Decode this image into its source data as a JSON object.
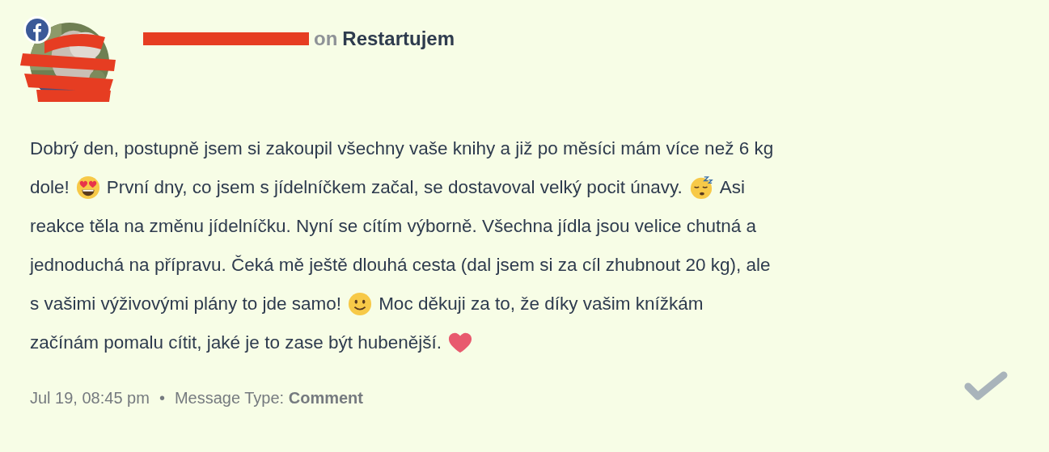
{
  "header": {
    "connector": "on",
    "page_name": "Restartujem"
  },
  "body": [
    [
      {
        "kind": "text",
        "text": "Dobrý den, postupně jsem si zakoupil všechny vaše knihy a již po měsíci mám více než 6 kg"
      }
    ],
    [
      {
        "kind": "text",
        "text": "dole!"
      },
      {
        "kind": "heart_eyes"
      },
      {
        "kind": "text",
        "text": "První dny, co jsem s jídelníčkem začal, se dostavoval velký pocit únavy."
      },
      {
        "kind": "sleepy"
      },
      {
        "kind": "text",
        "text": "Asi"
      }
    ],
    [
      {
        "kind": "text",
        "text": "reakce těla na změnu jídelníčku. Nyní se cítím výborně. Všechna jídla jsou velice chutná a"
      }
    ],
    [
      {
        "kind": "text",
        "text": "jednoduchá na přípravu. Čeká mě ještě dlouhá cesta (dal jsem si za cíl zhubnout 20 kg), ale"
      }
    ],
    [
      {
        "kind": "text",
        "text": "s vašimi výživovými plány to jde samo!"
      },
      {
        "kind": "smile"
      },
      {
        "kind": "text",
        "text": "Moc děkuji za to, že díky vašim knížkám"
      }
    ],
    [
      {
        "kind": "text",
        "text": "začínám pomalu cítit, jaké je to zase být hubenější."
      },
      {
        "kind": "heart"
      }
    ]
  ],
  "footer": {
    "time": "Jul 19, 08:45 pm",
    "separator": "•",
    "type_text": "Message Type: **Comment**"
  }
}
